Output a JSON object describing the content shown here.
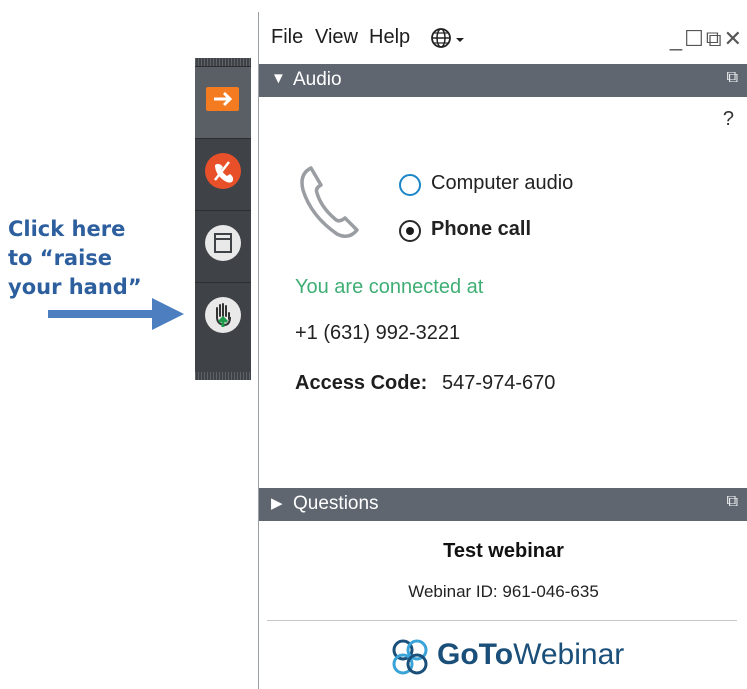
{
  "annotation": {
    "line1": "Click here",
    "line2": "to “raise",
    "line3": "your hand”"
  },
  "toolbar": {
    "items": [
      {
        "icon": "arrow-right-icon"
      },
      {
        "icon": "hang-up-phone-icon"
      },
      {
        "icon": "window-panel-icon"
      },
      {
        "icon": "raise-hand-icon"
      }
    ]
  },
  "menubar": {
    "file": "File",
    "view": "View",
    "help": "Help",
    "language_icon": "globe-icon"
  },
  "audio_panel": {
    "title": "Audio",
    "help": "?",
    "options": {
      "computer": "Computer audio",
      "phone": "Phone call",
      "selected": "phone"
    },
    "connected_text": "You are connected at",
    "phone_number": "+1 (631) 992-3221",
    "access_label": "Access Code:",
    "access_code": "547-974-670"
  },
  "questions_panel": {
    "title": "Questions"
  },
  "webinar": {
    "title": "Test webinar",
    "id_text": "Webinar ID: 961-046-635",
    "logo_bold": "GoTo",
    "logo_regular": "Webinar"
  },
  "colors": {
    "accent_orange": "#f47b20",
    "hangup_red": "#e8502a",
    "panel_header": "#5f6670",
    "connected_green": "#3fae74",
    "annotation_blue": "#2d5f9e"
  }
}
